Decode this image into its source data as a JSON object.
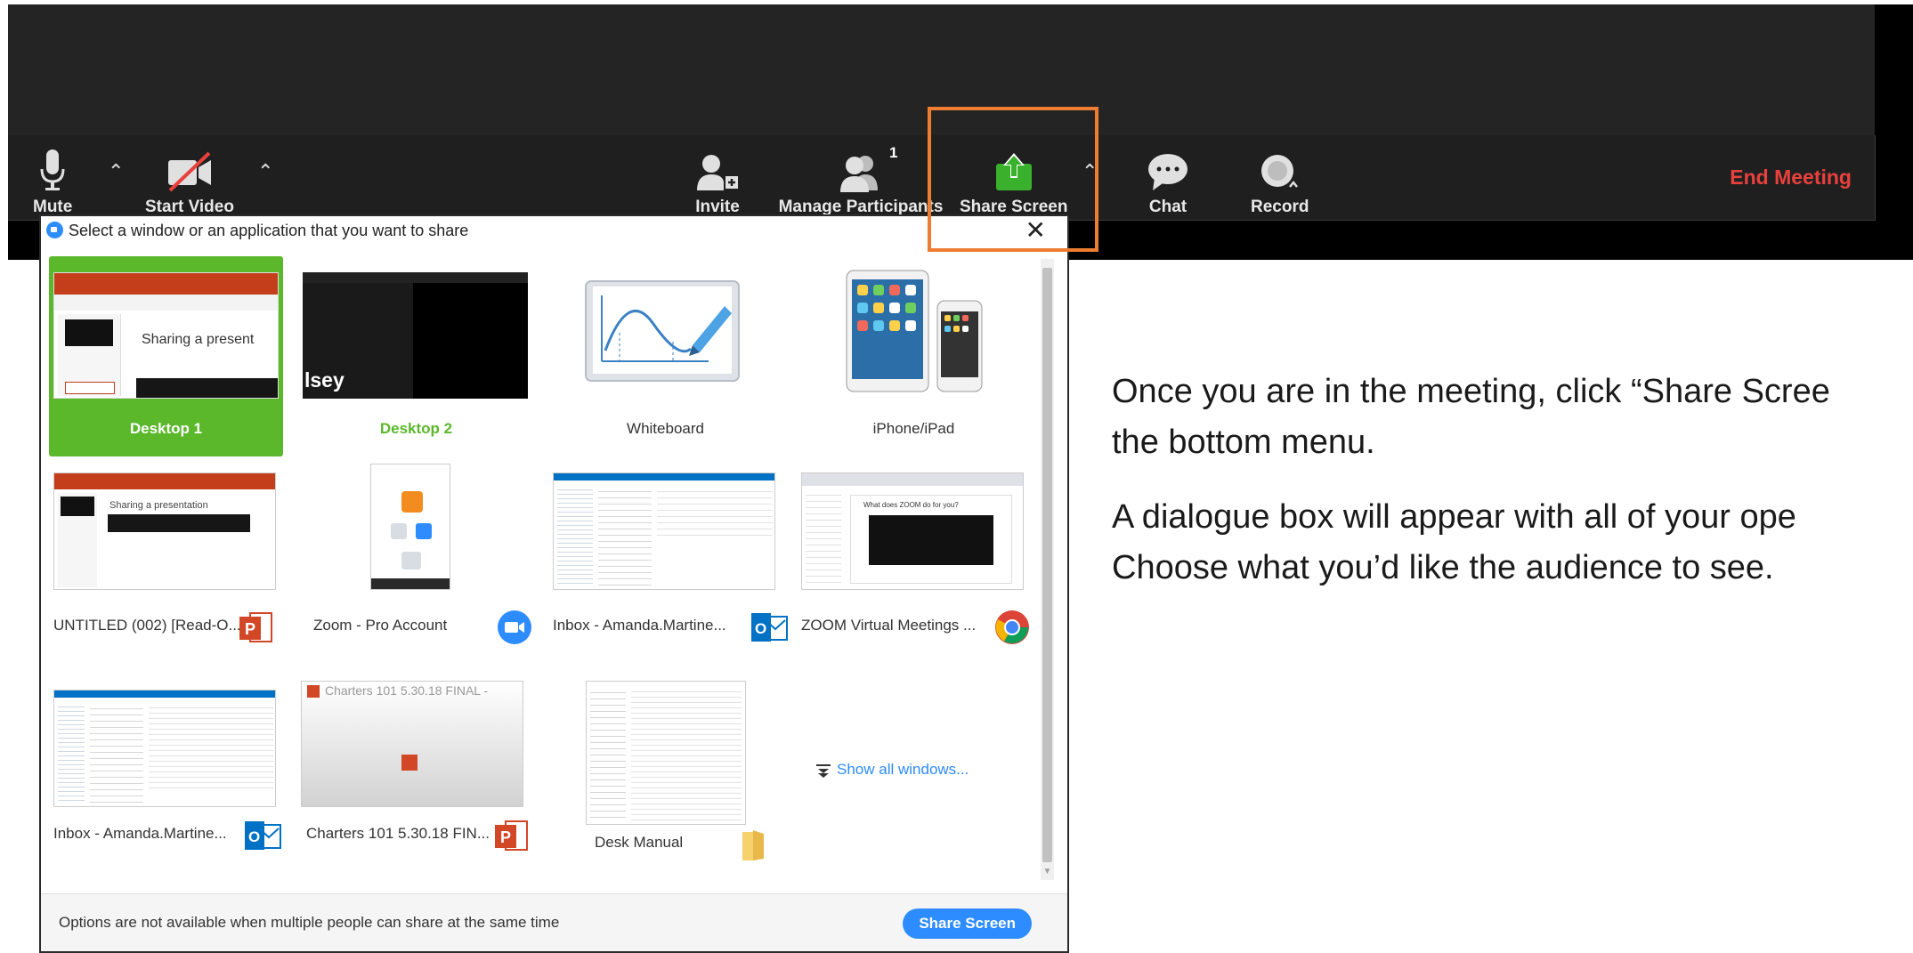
{
  "toolbar": {
    "mute_label": "Mute",
    "start_video_label": "Start Video",
    "invite_label": "Invite",
    "manage_participants_label": "Manage Participants",
    "participants_count": "1",
    "share_screen_label": "Share Screen",
    "chat_label": "Chat",
    "record_label": "Record",
    "end_meeting_label": "End Meeting",
    "caret": "⌃"
  },
  "dialog": {
    "title": "Select a window or an application that you want to share",
    "close": "✕",
    "footer_note": "Options are not available when multiple people can share at the same time",
    "share_button": "Share Screen",
    "show_all_windows": "Show all windows...",
    "tiles": [
      {
        "label": "Desktop 1",
        "selected": true
      },
      {
        "label": "Desktop 2"
      },
      {
        "label": "Whiteboard"
      },
      {
        "label": "iPhone/iPad"
      },
      {
        "label": "UNTITLED (002) [Read-O...",
        "icon": "powerpoint-icon"
      },
      {
        "label": "Zoom - Pro Account",
        "icon": "zoom-icon"
      },
      {
        "label": "Inbox - Amanda.Martine...",
        "icon": "outlook-icon"
      },
      {
        "label": "ZOOM Virtual Meetings ...",
        "icon": "chrome-icon"
      },
      {
        "label": "Inbox - Amanda.Martine...",
        "icon": "outlook-icon"
      },
      {
        "label": "Charters 101 5.30.18 FIN...",
        "icon": "powerpoint-icon"
      },
      {
        "label": "Desk Manual",
        "icon": "folder-icon"
      }
    ],
    "thumb_text": {
      "desktop1": "Sharing a present",
      "desktop2": "lsey",
      "ppt_slide": "Sharing a presentation",
      "charters": "Charters 101 5.30.18 FINAL -",
      "zoom_slide": "What does ZOOM do for you?"
    }
  },
  "instructions": {
    "para1_line1": "Once you are in the meeting, click “Share Scree",
    "para1_line2": "the bottom menu.",
    "para2_line1": "A dialogue box will appear with all of your ope",
    "para2_line2": "Choose what you’d like the audience to see."
  },
  "colors": {
    "accent_blue": "#2d8cff",
    "share_green": "#39b12d",
    "end_red": "#e8413d",
    "highlight_orange": "#ed7d31",
    "selected_tile": "#5ab82a"
  }
}
